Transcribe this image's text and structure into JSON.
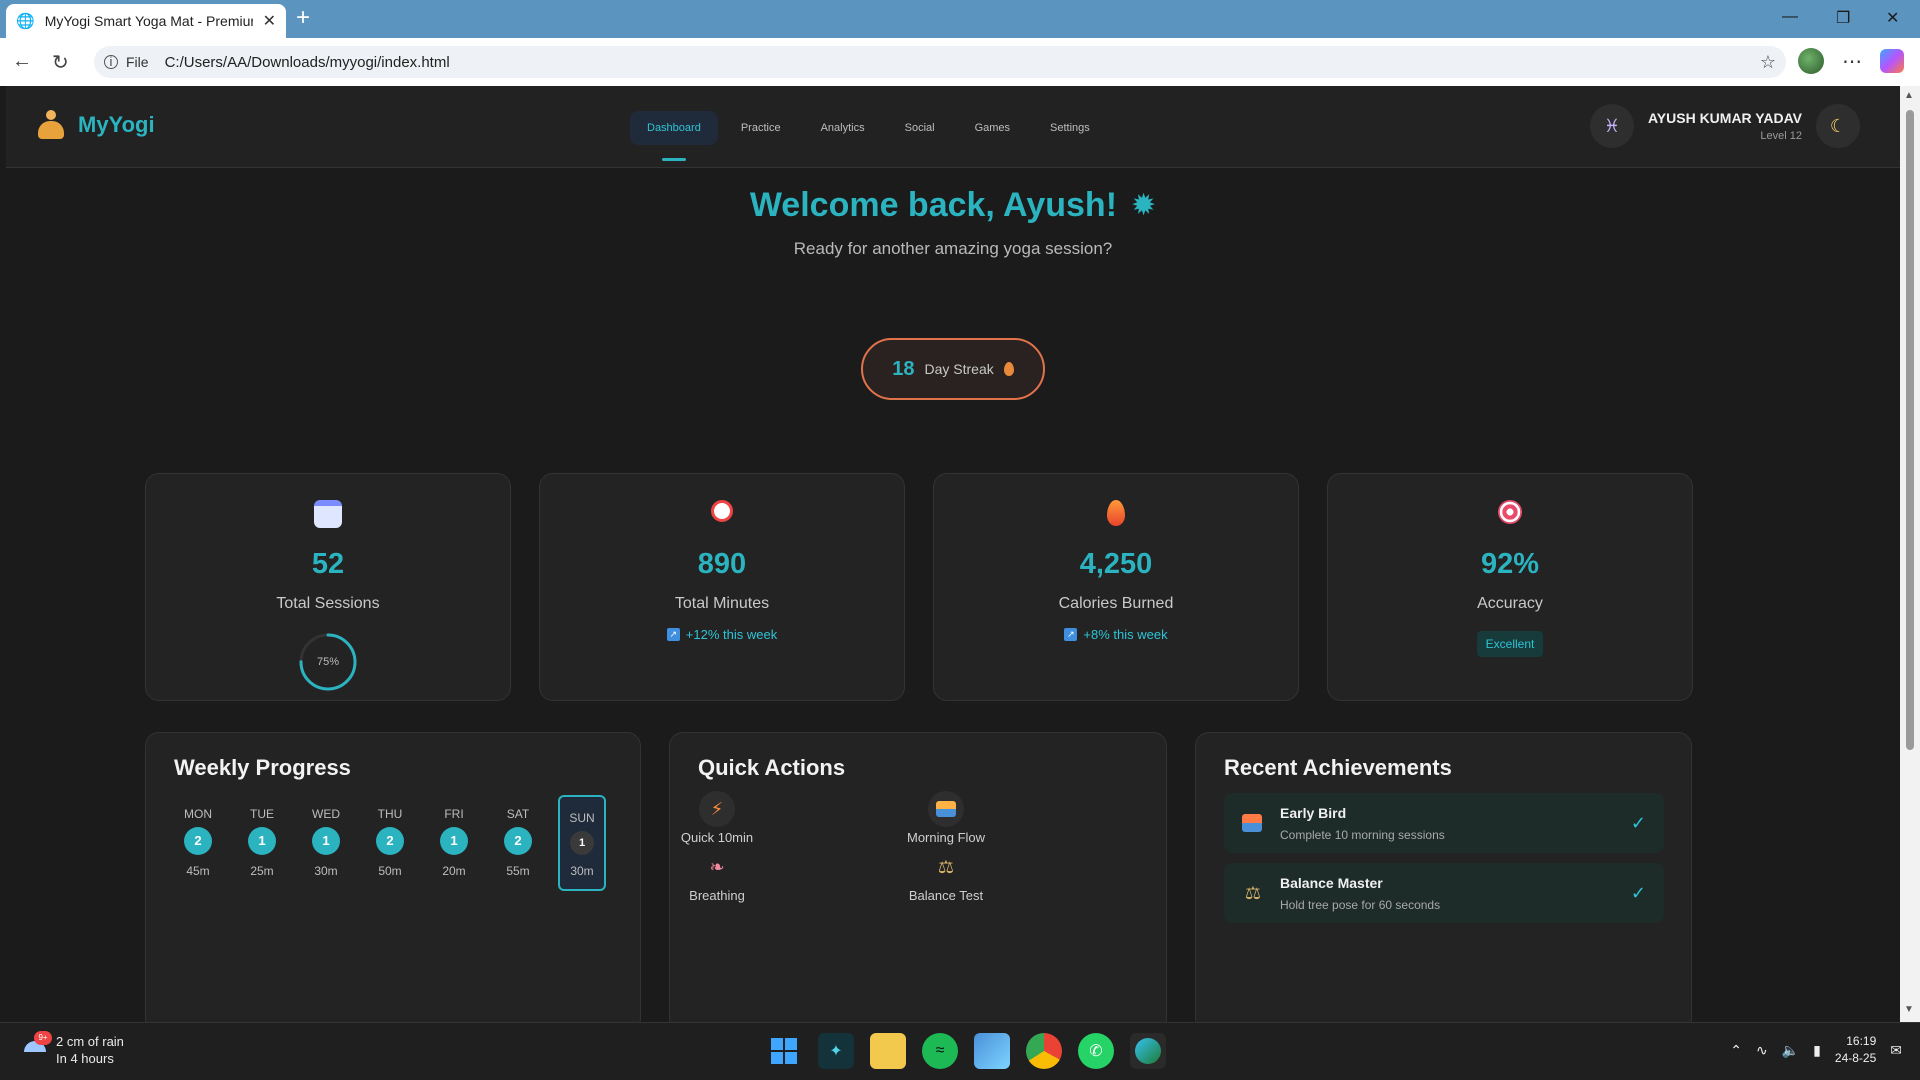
{
  "browser": {
    "tab_title": "MyYogi Smart Yoga Mat - Premium",
    "file_label": "File",
    "url": "C:/Users/AA/Downloads/myyogi/index.html"
  },
  "app": {
    "brand": "MyYogi",
    "nav": [
      {
        "label": "Dashboard",
        "active": true
      },
      {
        "label": "Practice",
        "active": false
      },
      {
        "label": "Analytics",
        "active": false
      },
      {
        "label": "Social",
        "active": false
      },
      {
        "label": "Games",
        "active": false
      },
      {
        "label": "Settings",
        "active": false
      }
    ],
    "user": {
      "name": "AYUSH KUMAR YADAV",
      "level": "Level 12"
    },
    "accent": "#2bb3c0"
  },
  "hero": {
    "title": "Welcome back, Ayush!",
    "subtitle": "Ready for another amazing yoga session?",
    "streak_count": "18",
    "streak_label": "Day Streak"
  },
  "stats": [
    {
      "icon": "calendar-icon",
      "value": "52",
      "label": "Total Sessions",
      "progress_text": "75%",
      "progress": 0.75
    },
    {
      "icon": "alarm-clock-icon",
      "value": "890",
      "label": "Total Minutes",
      "trend": "+12% this week"
    },
    {
      "icon": "flame-icon",
      "value": "4,250",
      "label": "Calories Burned",
      "trend": "+8% this week"
    },
    {
      "icon": "target-icon",
      "value": "92%",
      "label": "Accuracy",
      "badge": "Excellent"
    }
  ],
  "weekly": {
    "title": "Weekly Progress",
    "days": [
      {
        "name": "MON",
        "count": "2",
        "minutes": "45m"
      },
      {
        "name": "TUE",
        "count": "1",
        "minutes": "25m"
      },
      {
        "name": "WED",
        "count": "1",
        "minutes": "30m"
      },
      {
        "name": "THU",
        "count": "2",
        "minutes": "50m"
      },
      {
        "name": "FRI",
        "count": "1",
        "minutes": "20m"
      },
      {
        "name": "SAT",
        "count": "2",
        "minutes": "55m"
      },
      {
        "name": "SUN",
        "count": "1",
        "minutes": "30m",
        "today": true
      }
    ]
  },
  "quick_actions": {
    "title": "Quick Actions",
    "items": [
      {
        "label": "Quick 10min",
        "icon": "lightning-icon"
      },
      {
        "label": "Morning Flow",
        "icon": "sunrise-icon"
      },
      {
        "label": "Breathing",
        "icon": "lungs-icon"
      },
      {
        "label": "Balance Test",
        "icon": "scales-icon"
      }
    ]
  },
  "achievements": {
    "title": "Recent Achievements",
    "items": [
      {
        "title": "Early Bird",
        "desc": "Complete 10 morning sessions",
        "icon": "sunrise-icon"
      },
      {
        "title": "Balance Master",
        "desc": "Hold tree pose for 60 seconds",
        "icon": "scales-icon"
      }
    ]
  },
  "taskbar": {
    "weather_line1": "2 cm of rain",
    "weather_line2": "In 4 hours",
    "weather_badge": "9+",
    "time": "16:19",
    "date": "24-8-25"
  }
}
